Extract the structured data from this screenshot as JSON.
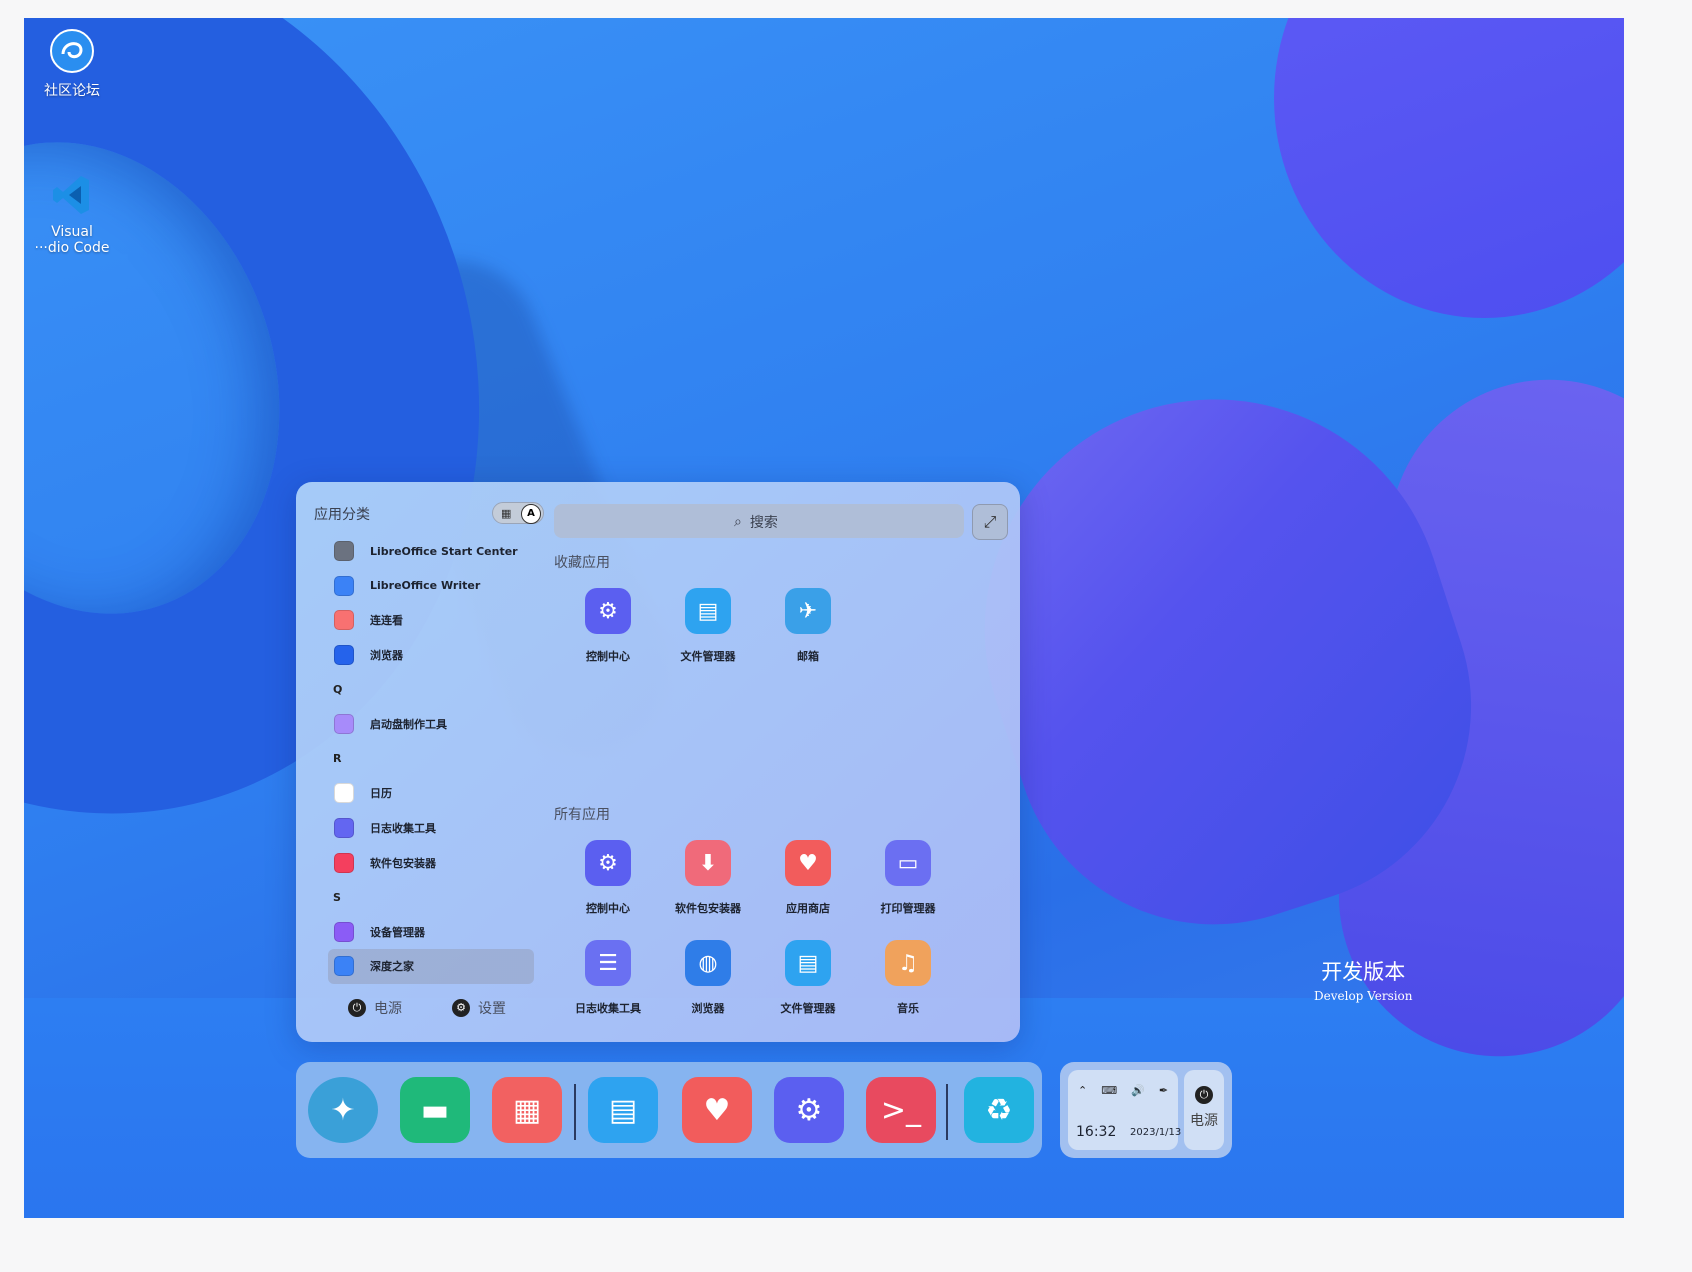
{
  "desktop": {
    "icons": [
      {
        "label": "社区论坛",
        "icon": "deepin-forum-icon"
      },
      {
        "label": "Visual\n···dio Code",
        "icon": "vscode-icon"
      }
    ],
    "watermark": {
      "line1": "开发版本",
      "line2": "Develop Version"
    }
  },
  "launcher": {
    "category_title": "应用分类",
    "view_toggle": {
      "left": "▦",
      "right": "A"
    },
    "search_placeholder": "搜索",
    "list": [
      {
        "type": "app",
        "label": "LibreOffice Start Center",
        "color": "#6b7280"
      },
      {
        "type": "app",
        "label": "LibreOffice Writer",
        "color": "#3b82f6"
      },
      {
        "type": "app",
        "label": "连连看",
        "color": "#f87171"
      },
      {
        "type": "app",
        "label": "浏览器",
        "color": "#2563eb"
      },
      {
        "type": "letter",
        "label": "Q"
      },
      {
        "type": "app",
        "label": "启动盘制作工具",
        "color": "#a78bfa"
      },
      {
        "type": "letter",
        "label": "R"
      },
      {
        "type": "app",
        "label": "日历",
        "color": "#ffffff"
      },
      {
        "type": "app",
        "label": "日志收集工具",
        "color": "#6366f1"
      },
      {
        "type": "app",
        "label": "软件包安装器",
        "color": "#f43f5e"
      },
      {
        "type": "letter",
        "label": "S"
      },
      {
        "type": "app",
        "label": "设备管理器",
        "color": "#8b5cf6"
      },
      {
        "type": "app",
        "label": "深度之家",
        "color": "#3b82f6",
        "selected": true
      }
    ],
    "power_label": "电源",
    "settings_label": "设置",
    "favorites_title": "收藏应用",
    "favorites": [
      {
        "label": "控制中心",
        "icon": "gear-icon",
        "color": "#5b5ff0"
      },
      {
        "label": "文件管理器",
        "icon": "folder-icon",
        "color": "#2ea3f0"
      },
      {
        "label": "邮箱",
        "icon": "mail-icon",
        "color": "#3aa0e8"
      }
    ],
    "all_title": "所有应用",
    "all_apps": [
      {
        "label": "控制中心",
        "icon": "gear-icon",
        "color": "#5b5ff0"
      },
      {
        "label": "软件包安装器",
        "icon": "package-icon",
        "color": "#f06a7a"
      },
      {
        "label": "应用商店",
        "icon": "store-icon",
        "color": "#f25c5c"
      },
      {
        "label": "打印管理器",
        "icon": "printer-icon",
        "color": "#6b6ff2"
      },
      {
        "label": "日志收集工具",
        "icon": "log-icon",
        "color": "#6a70f2"
      },
      {
        "label": "浏览器",
        "icon": "browser-icon",
        "color": "#2f7de8"
      },
      {
        "label": "文件管理器",
        "icon": "folder-icon",
        "color": "#2ea3f0"
      },
      {
        "label": "音乐",
        "icon": "music-icon",
        "color": "#f0a25c"
      }
    ]
  },
  "dock": {
    "apps": [
      {
        "name": "launcher-icon",
        "color": "#3aa0d8"
      },
      {
        "name": "multitask-icon",
        "color": "#1fb97a"
      },
      {
        "name": "app-grid-icon",
        "color": "#f26161"
      },
      {
        "name": "file-manager-icon",
        "color": "#2ea3f0"
      },
      {
        "name": "app-store-icon",
        "color": "#f25c5c"
      },
      {
        "name": "control-center-icon",
        "color": "#5b5ff0"
      },
      {
        "name": "terminal-icon",
        "color": "#e84a5f"
      },
      {
        "name": "trash-icon",
        "color": "#22b3e0"
      }
    ]
  },
  "tray": {
    "time": "16:32",
    "date": "2023/1/13",
    "power_label": "电源"
  }
}
